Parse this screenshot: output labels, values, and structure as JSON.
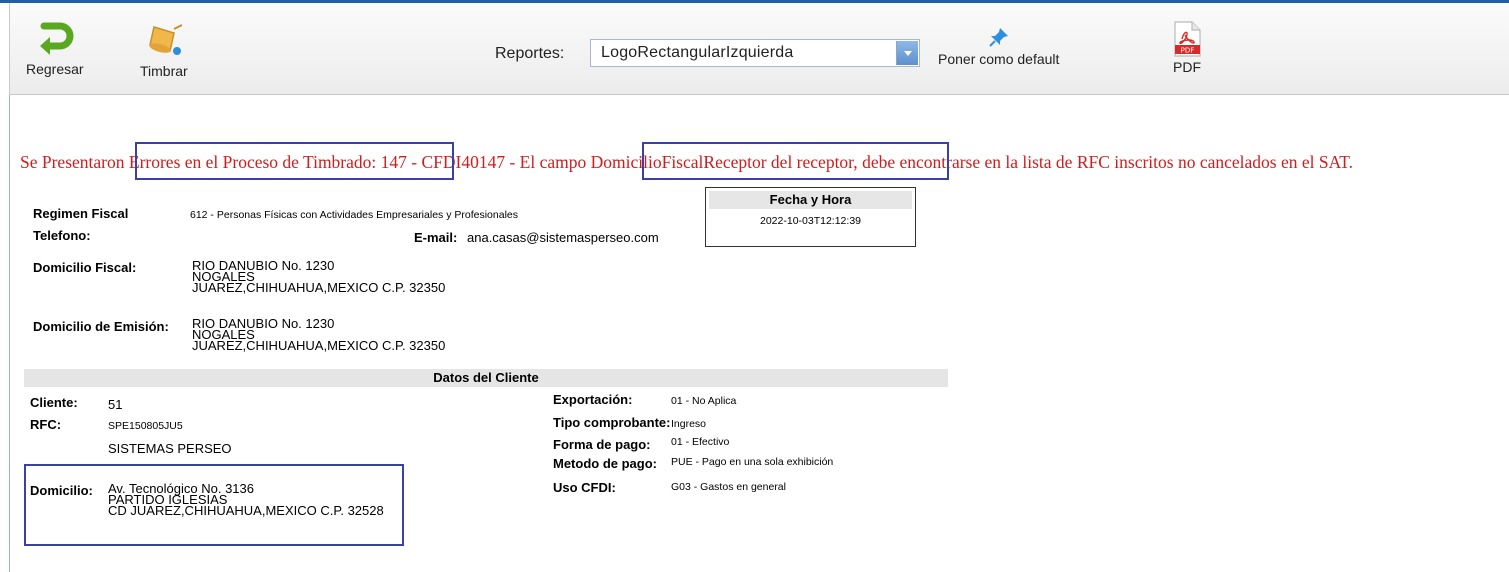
{
  "toolbar": {
    "back_label": "Regresar",
    "stamp_label": "Timbrar",
    "reports_label": "Reportes:",
    "reports_selected": "LogoRectangularIzquierda",
    "default_label": "Poner como default",
    "pdf_label": "PDF",
    "pdf_icon_text": "PDF"
  },
  "error": {
    "prefix": "Se Presentaron ",
    "part1": "Errores en el Proceso de Timbrado: 147",
    "middle": " - CFDI40147 - El campo ",
    "part2": "DomicilioFiscalReceptor del receptor,",
    "suffix": " debe encontrarse en la lista de RFC inscritos no cancelados en el SAT."
  },
  "issuer": {
    "regimen_label": "Regimen Fiscal",
    "regimen_value": "612 - Personas Físicas con Actividades Empresariales y Profesionales",
    "telefono_label": "Telefono:",
    "email_label": "E-mail:",
    "email_value": "ana.casas@sistemasperseo.com",
    "domicilio_fiscal_label": "Domicilio Fiscal:",
    "domicilio_fiscal": [
      "RIO DANUBIO No. 1230",
      "NOGALES",
      "JUAREZ,CHIHUAHUA,MEXICO C.P. 32350"
    ],
    "domicilio_emision_label": "Domicilio de Emisión:",
    "domicilio_emision": [
      "RIO DANUBIO No. 1230",
      "NOGALES",
      "JUAREZ,CHIHUAHUA,MEXICO C.P. 32350"
    ]
  },
  "fecha": {
    "header": "Fecha y Hora",
    "value": "2022-10-03T12:12:39"
  },
  "client": {
    "section_title": "Datos del Cliente",
    "cliente_label": "Cliente:",
    "cliente_value": "51",
    "rfc_label": "RFC:",
    "rfc_value": "SPE150805JU5",
    "name": "SISTEMAS PERSEO",
    "domicilio_label": "Domicilio:",
    "domicilio": [
      "Av. Tecnológico No. 3136",
      "PARTIDO IGLESIAS",
      "CD JUAREZ,CHIHUAHUA,MEXICO C.P. 32528"
    ],
    "exportacion_label": "Exportación:",
    "exportacion_value": "01 - No Aplica",
    "tipo_label": "Tipo comprobante:",
    "tipo_value": "Ingreso",
    "forma_label": "Forma de pago:",
    "forma_value": "01 - Efectivo",
    "metodo_label": "Metodo de pago:",
    "metodo_value": "PUE - Pago en una sola exhibición",
    "uso_label": "Uso CFDI:",
    "uso_value": "G03 - Gastos en general"
  }
}
